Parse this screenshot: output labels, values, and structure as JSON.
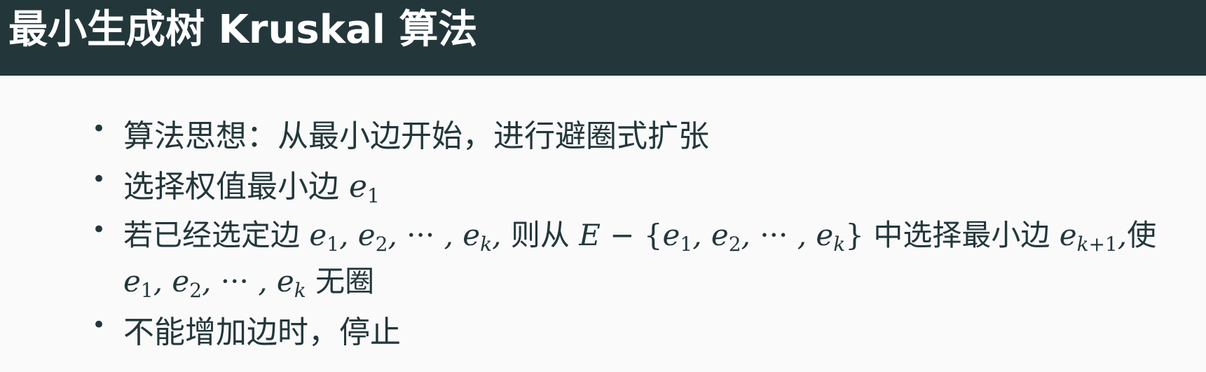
{
  "header": {
    "title": "最小生成树 Kruskal 算法"
  },
  "items": [
    {
      "bullet": "•",
      "text": "算法思想：从最小边开始，进行避圈式扩张"
    },
    {
      "bullet": "•",
      "text_prefix": "选择权值最小边",
      "math": "e",
      "sub": "1"
    },
    {
      "bullet": "•",
      "line1_prefix": "若已经选定边",
      "seq1": "e1, e2, ··· , ek,",
      "mid1": "则从",
      "set_expr": "E − {e1, e2, ··· , ek}",
      "mid2": "中选择最小边",
      "next_edge": "ek+1,",
      "end1": "使",
      "line2_seq": "e1, e2, ··· , ek",
      "line2_suffix": "无圈"
    },
    {
      "bullet": "•",
      "text": "不能增加边时，停止"
    }
  ],
  "colors": {
    "header_bg": "#23373b",
    "header_text": "#ffffff",
    "body_bg": "#fafafa",
    "body_text": "#23373b"
  }
}
